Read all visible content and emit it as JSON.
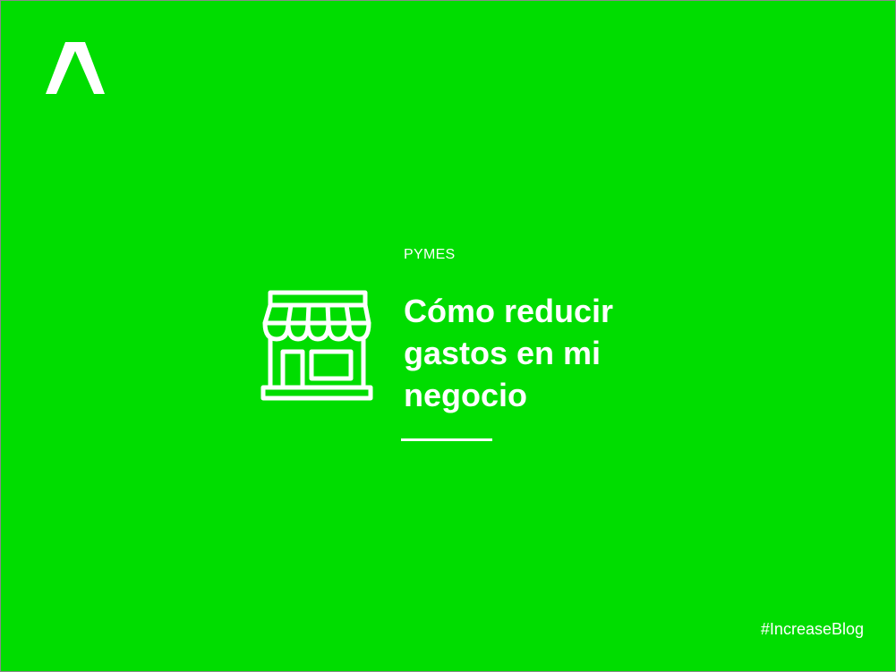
{
  "colors": {
    "background": "#00dd00",
    "foreground": "#ffffff",
    "border": "#8a8a8a"
  },
  "logo": {
    "icon": "chevron-up-logo"
  },
  "article": {
    "category": "PYMES",
    "title": "Cómo reducir gastos en mi negocio",
    "icon": "store-icon"
  },
  "footer": {
    "hashtag": "#IncreaseBlog"
  }
}
